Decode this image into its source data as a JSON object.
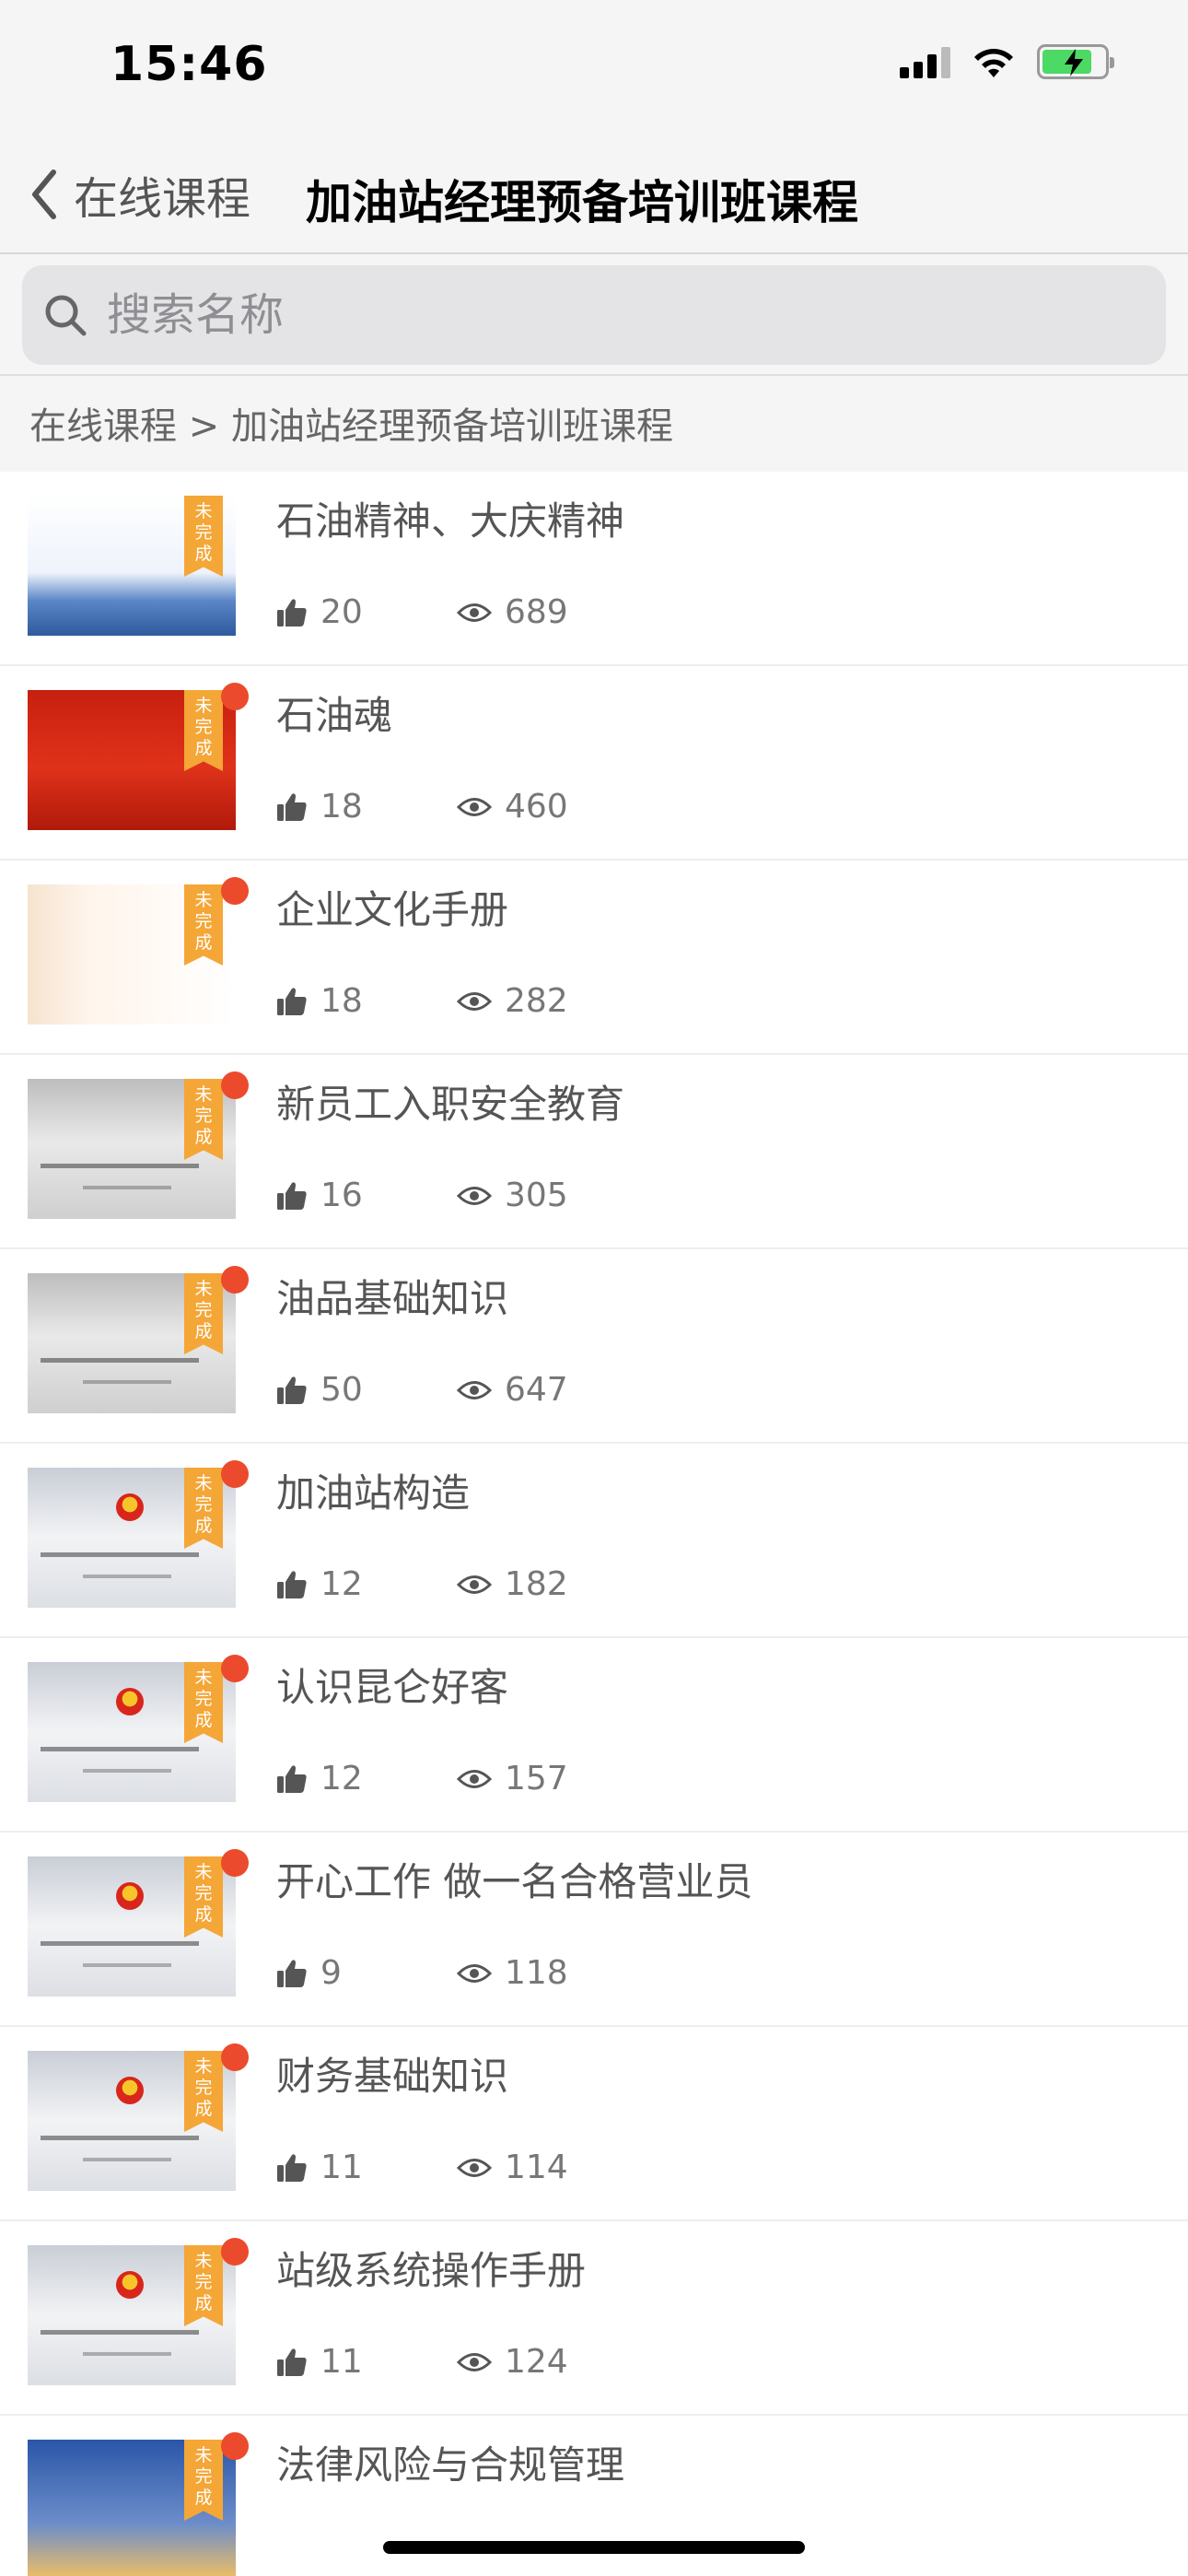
{
  "status_bar": {
    "time": "15:46",
    "signal_icon": "cellular-signal-icon",
    "wifi_icon": "wifi-icon",
    "battery_icon": "battery-charging-icon",
    "battery_level": 0.8
  },
  "nav": {
    "back_icon": "chevron-left-icon",
    "back_label": "在线课程",
    "title": "加油站经理预备培训班课程"
  },
  "search": {
    "icon": "search-icon",
    "placeholder": "搜索名称",
    "value": ""
  },
  "breadcrumb": "在线课程 > 加油站经理预备培训班课程",
  "badge_label": "未完成",
  "colors": {
    "accent_orange": "#f4a637",
    "unread_red": "#ec4a2c",
    "background": "#f5f5f5",
    "title_black": "#000000"
  },
  "courses": [
    {
      "title": "石油精神、大庆精神",
      "likes": "20",
      "views": "689",
      "has_dot": false,
      "thumb_style": "blue-city"
    },
    {
      "title": "石油魂",
      "likes": "18",
      "views": "460",
      "has_dot": true,
      "thumb_style": "red-calligraphy"
    },
    {
      "title": "企业文化手册",
      "likes": "18",
      "views": "282",
      "has_dot": true,
      "thumb_style": "white-orange"
    },
    {
      "title": "新员工入职安全教育",
      "likes": "16",
      "views": "305",
      "has_dot": true,
      "thumb_style": "gray-plain"
    },
    {
      "title": "油品基础知识",
      "likes": "50",
      "views": "647",
      "has_dot": true,
      "thumb_style": "gray-plain"
    },
    {
      "title": "加油站构造",
      "likes": "12",
      "views": "182",
      "has_dot": true,
      "thumb_style": "light-logo"
    },
    {
      "title": "认识昆仑好客",
      "likes": "12",
      "views": "157",
      "has_dot": true,
      "thumb_style": "light-logo"
    },
    {
      "title": "开心工作 做一名合格营业员",
      "likes": "9",
      "views": "118",
      "has_dot": true,
      "thumb_style": "light-logo"
    },
    {
      "title": "财务基础知识",
      "likes": "11",
      "views": "114",
      "has_dot": true,
      "thumb_style": "light-logo"
    },
    {
      "title": "站级系统操作手册",
      "likes": "11",
      "views": "124",
      "has_dot": true,
      "thumb_style": "light-logo"
    },
    {
      "title": "法律风险与合规管理",
      "likes": "",
      "views": "",
      "has_dot": true,
      "thumb_style": "blue-sunrise"
    }
  ]
}
